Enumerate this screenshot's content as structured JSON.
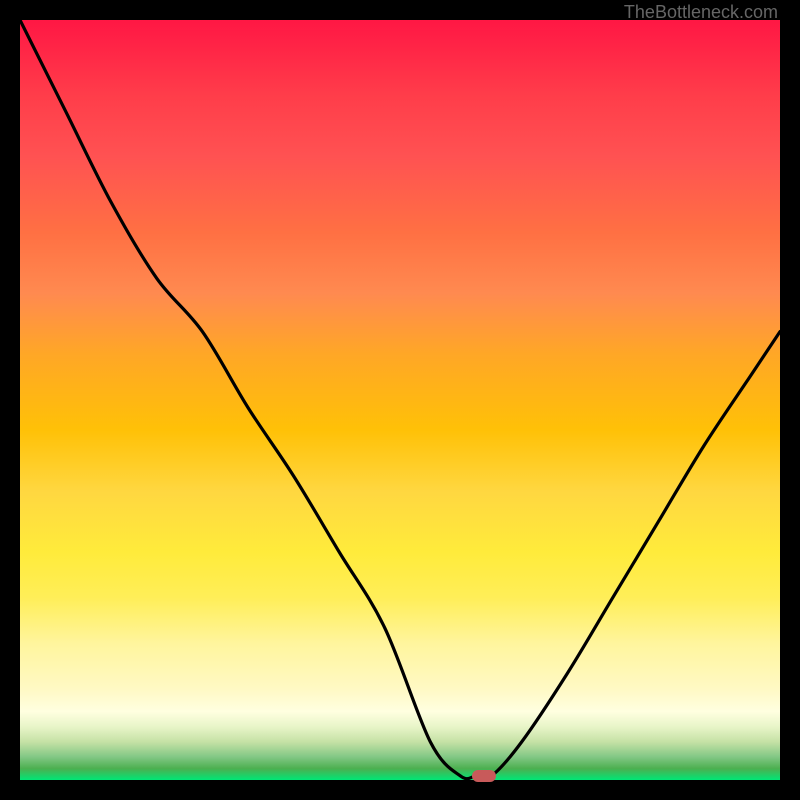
{
  "watermark": "TheBottleneck.com",
  "chart_data": {
    "type": "line",
    "title": "",
    "xlabel": "",
    "ylabel": "",
    "xlim": [
      0,
      1
    ],
    "ylim": [
      0,
      1
    ],
    "x": [
      0.0,
      0.06,
      0.12,
      0.18,
      0.24,
      0.3,
      0.36,
      0.42,
      0.48,
      0.54,
      0.58,
      0.6,
      0.62,
      0.66,
      0.72,
      0.78,
      0.84,
      0.9,
      0.96,
      1.0
    ],
    "y": [
      1.0,
      0.88,
      0.76,
      0.66,
      0.59,
      0.49,
      0.4,
      0.3,
      0.2,
      0.05,
      0.005,
      0.005,
      0.005,
      0.05,
      0.14,
      0.24,
      0.34,
      0.44,
      0.53,
      0.59
    ],
    "marker": {
      "x": 0.61,
      "y": 0.005
    },
    "gradient_stops": [
      {
        "pos": 0.0,
        "color": "#ff1744"
      },
      {
        "pos": 0.5,
        "color": "#ffc107"
      },
      {
        "pos": 0.8,
        "color": "#ffeb3b"
      },
      {
        "pos": 0.92,
        "color": "#fff9c4"
      },
      {
        "pos": 1.0,
        "color": "#00e676"
      }
    ]
  }
}
